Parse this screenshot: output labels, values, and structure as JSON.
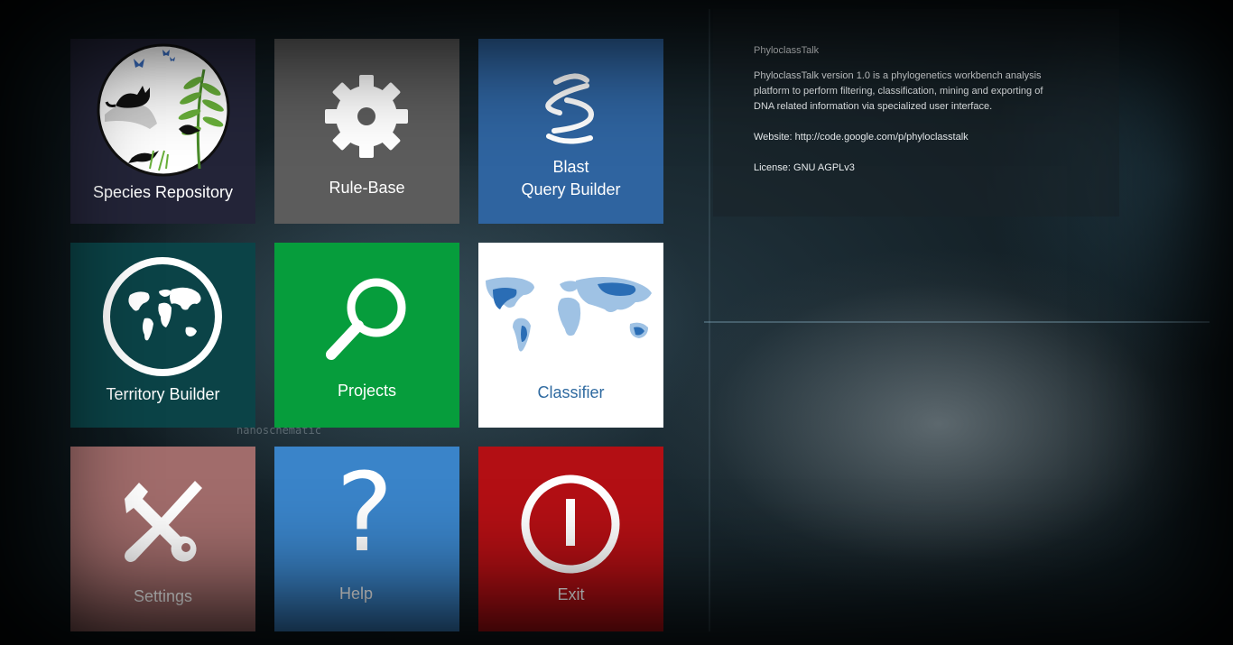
{
  "tiles": {
    "species_repository": {
      "label": "Species Repository",
      "color": "#232438"
    },
    "rule_base": {
      "label": "Rule-Base",
      "color": "#5c5c5c"
    },
    "blast_query_builder": {
      "label_line1": "Blast",
      "label_line2": "Query Builder",
      "color": "#2f64a0"
    },
    "territory_builder": {
      "label": "Territory Builder",
      "color": "#0b4347"
    },
    "projects": {
      "label": "Projects",
      "color": "#069d3c"
    },
    "classifier": {
      "label": "Classifier",
      "color": "#ffffff",
      "label_color": "#2f6aa0"
    },
    "settings": {
      "label": "Settings",
      "color": "#a16c6b"
    },
    "help": {
      "label": "Help",
      "color": "#3a84c9"
    },
    "exit": {
      "label": "Exit",
      "color": "#b30f14"
    }
  },
  "about": {
    "title": "PhyloclassTalk",
    "description": "PhyloclassTalk version 1.0 is a phylogenetics workbench analysis platform to perform filtering, classification, mining and exporting of DNA related information via specialized user interface.",
    "website": "Website: http://code.google.com/p/phyloclasstalk",
    "license": "License: GNU AGPLv3"
  },
  "background": {
    "watermark": "nanoschematic"
  },
  "icons": [
    "wildlife-icon",
    "gear-icon",
    "dna-helix-icon",
    "globe-icon",
    "magnifier-icon",
    "world-map-icon",
    "tools-icon",
    "question-icon",
    "power-icon"
  ]
}
